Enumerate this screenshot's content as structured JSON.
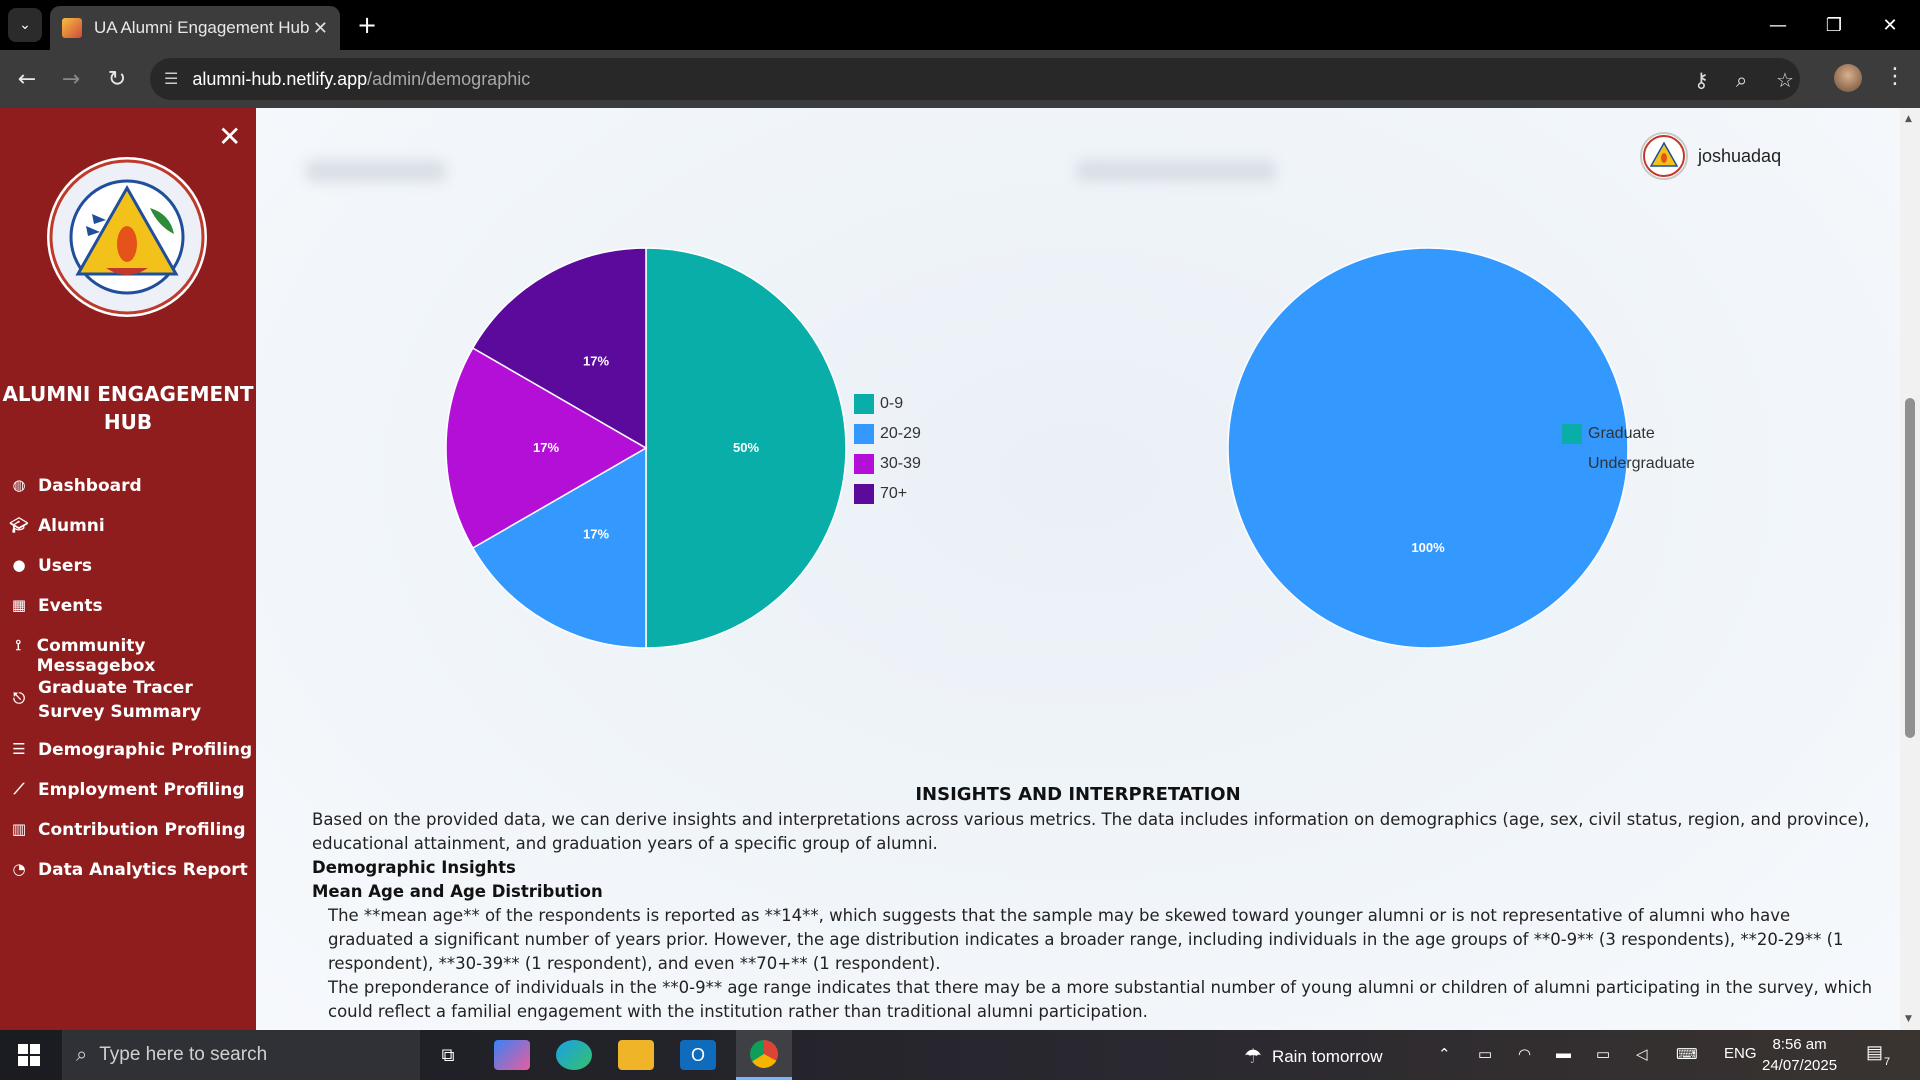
{
  "browser": {
    "tab_title": "UA Alumni Engagement Hub",
    "url_host": "alumni-hub.netlify.app",
    "url_path": "/admin/demographic"
  },
  "sidebar": {
    "title": "ALUMNI ENGAGEMENT HUB",
    "items": [
      {
        "label": "Dashboard",
        "icon": "palette-icon"
      },
      {
        "label": "Alumni",
        "icon": "graduation-cap-icon"
      },
      {
        "label": "Users",
        "icon": "user-icon"
      },
      {
        "label": "Events",
        "icon": "calendar-icon"
      },
      {
        "label": "Community Messagebox",
        "icon": "broadcast-icon"
      },
      {
        "label": "Graduate Tracer Survey Summary",
        "icon": "paperclip-icon"
      },
      {
        "label": "Demographic Profiling",
        "icon": "list-icon"
      },
      {
        "label": "Employment Profiling",
        "icon": "line-chart-icon"
      },
      {
        "label": "Contribution Profiling",
        "icon": "bar-chart-icon"
      },
      {
        "label": "Data Analytics Report",
        "icon": "pie-chart-icon"
      }
    ]
  },
  "header": {
    "username": "joshuadaq"
  },
  "chart_data": [
    {
      "type": "pie",
      "categories": [
        "0-9",
        "20-29",
        "30-39",
        "70+"
      ],
      "values": [
        3,
        1,
        1,
        1
      ],
      "labels": [
        "50%",
        "17%",
        "17%",
        "17%"
      ],
      "colors": [
        "#0aaea8",
        "#3399ff",
        "#b30fd6",
        "#5c0a9c"
      ],
      "legend": "right"
    },
    {
      "type": "pie",
      "categories": [
        "Graduate",
        "Undergraduate"
      ],
      "values": [
        0,
        100
      ],
      "labels": [
        "0%",
        "100%"
      ],
      "colors": [
        "#0aaea8",
        "#3399ff"
      ],
      "legend": "right"
    }
  ],
  "insights": {
    "title": "INSIGHTS AND INTERPRETATION",
    "intro": "Based on the provided data, we can derive insights and interpretations across various metrics. The data includes information on demographics (age, sex, civil status, region, and province), educational attainment, and graduation years of a specific group of alumni.",
    "section_heading": "Demographic Insights",
    "subheading": "Mean Age and Age Distribution",
    "p1": "The **mean age** of the respondents is reported as **14**, which suggests that the sample may be skewed toward younger alumni or is not representative of alumni who have graduated a significant number of years prior. However, the age distribution indicates a broader range, including individuals in the age groups of **0-9** (3 respondents), **20-29** (1 respondent), **30-39** (1 respondent), and even **70+** (1 respondent).",
    "p2": "The preponderance of individuals in the **0-9** age range indicates that there may be a more substantial number of young alumni or children of alumni participating in the survey, which could reflect a familial engagement with the institution rather than traditional alumni participation."
  },
  "taskbar": {
    "search_placeholder": "Type here to search",
    "weather": "Rain tomorrow",
    "language": "ENG",
    "time": "8:56 am",
    "date": "24/07/2025",
    "notification_count": "7"
  }
}
